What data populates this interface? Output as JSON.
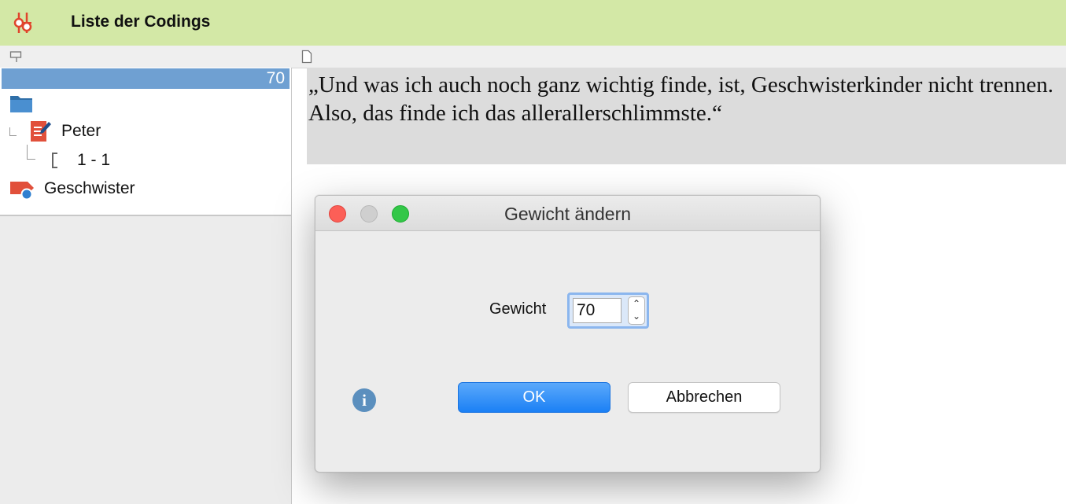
{
  "window": {
    "title": "Liste der Codings"
  },
  "tree": {
    "selected_weight": "70",
    "document": "Peter",
    "segment": "1 - 1",
    "code": "Geschwister"
  },
  "preview": {
    "text": "„Und was ich auch noch ganz wichtig finde, ist, Geschwisterkinder nicht trennen. Also, das finde ich das allerallerschlimmste.“"
  },
  "dialog": {
    "title": "Gewicht ändern",
    "label": "Gewicht",
    "value": "70",
    "ok_label": "OK",
    "cancel_label": "Abbrechen",
    "info_glyph": "i"
  },
  "colors": {
    "titlebar": "#d3e8a6",
    "selection": "#6fa0d2",
    "primary_button": "#1b80f5",
    "quote_bg": "#dcdcdc"
  }
}
